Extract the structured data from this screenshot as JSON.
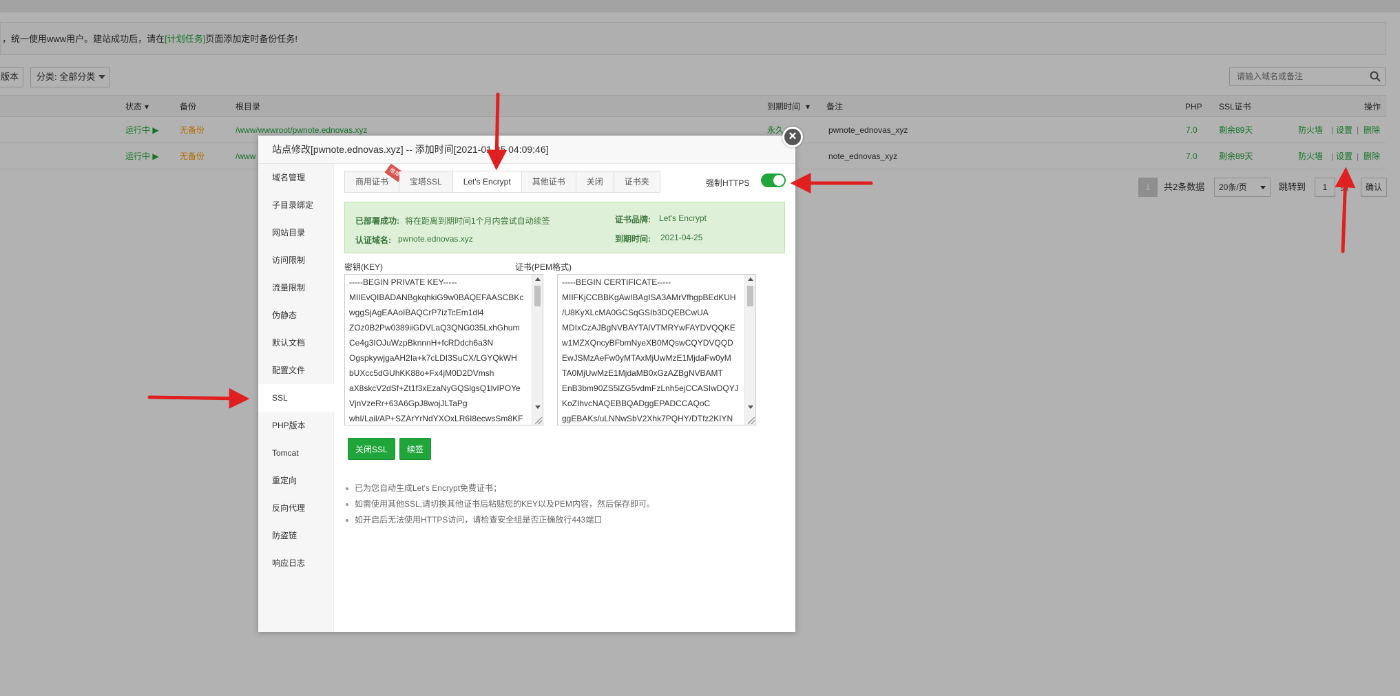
{
  "background": {
    "notice": {
      "text": "，统一使用www用户。建站成功后，请在",
      "link": "[计划任务]",
      "text_after": "页面添加定时备份任务!"
    },
    "toolbar": {
      "version_button": "版本",
      "category_select": "分类: 全部分类"
    },
    "search_placeholder": "请输入域名或备注",
    "table": {
      "headers": {
        "status": "状态",
        "backup": "备份",
        "root": "根目录",
        "expire": "到期时间",
        "remark": "备注",
        "php": "PHP",
        "ssl": "SSL证书",
        "ops": "操作"
      },
      "rows": [
        {
          "status": "运行中",
          "backup": "无备份",
          "root": "/www/wwwroot/pwnote.ednovas.xyz",
          "expire": "永久",
          "remark": "pwnote_ednovas_xyz",
          "php": "7.0",
          "ssl": "剩余89天",
          "firewall": "防火墙",
          "settings": "设置",
          "delete": "删除"
        },
        {
          "status": "运行中",
          "backup": "无备份",
          "root": "/www",
          "expire": "",
          "remark": "note_ednovas_xyz",
          "php": "7.0",
          "ssl": "剩余89天",
          "firewall": "防火墙",
          "settings": "设置",
          "delete": "删除"
        }
      ]
    },
    "pager": {
      "current": "1",
      "total": "共2条数据",
      "per_page": "20条/页",
      "jump_label": "跳转到",
      "jump_value": "1",
      "page_suffix": "页",
      "confirm": "确认"
    }
  },
  "dialog": {
    "title": "站点修改[pwnote.ednovas.xyz] -- 添加时间[2021-01-25 04:09:46]",
    "sidebar": [
      {
        "label": "域名管理"
      },
      {
        "label": "子目录绑定"
      },
      {
        "label": "网站目录"
      },
      {
        "label": "访问限制"
      },
      {
        "label": "流量限制"
      },
      {
        "label": "伪静态"
      },
      {
        "label": "默认文档"
      },
      {
        "label": "配置文件"
      },
      {
        "label": "SSL",
        "active": true
      },
      {
        "label": "PHP版本"
      },
      {
        "label": "Tomcat"
      },
      {
        "label": "重定向"
      },
      {
        "label": "反向代理"
      },
      {
        "label": "防盗链"
      },
      {
        "label": "响应日志"
      }
    ],
    "tabs": [
      {
        "label": "商用证书",
        "ribbon": "推荐"
      },
      {
        "label": "宝塔SSL"
      },
      {
        "label": "Let's Encrypt",
        "active": true
      },
      {
        "label": "其他证书"
      },
      {
        "label": "关闭"
      },
      {
        "label": "证书夹"
      }
    ],
    "force_https": {
      "label": "强制HTTPS",
      "enabled": true
    },
    "status": {
      "deployed_key": "已部署成功:",
      "deployed_val": "将在距离到期时间1个月内尝试自动续签",
      "domain_key": "认证域名:",
      "domain_val": "pwnote.ednovas.xyz",
      "brand_key": "证书品牌:",
      "brand_val": "Let's Encrypt",
      "expire_key": "到期时间:",
      "expire_val": "2021-04-25"
    },
    "key_label": "密钥(KEY)",
    "cert_label": "证书(PEM格式)",
    "key_lines": [
      "-----BEGIN PRIVATE KEY-----",
      "MIIEvQIBADANBgkqhkiG9w0BAQEFAASCBKc",
      "wggSjAgEAAoIBAQCrP7izTcEm1dl4",
      "ZOz0B2Pw0389iiGDVLaQ3QNG035LxhGhum",
      "Ce4g3IOJuWzpBknnnH+fcRDdch6a3N",
      "OgspkywjgaAH2Ia+k7cLDI3SuCX/LGYQkWH",
      "bUXcc5dGUhKK88o+Fx4jM0D2DVmsh",
      "aX8skcV2dSf+Zt1f3xEzaNyGQSlgsQ1lvIPOYe",
      "VjnVzeRr+63A6GpJ8wojJLTaPg",
      "whI/Lail/AP+SZArYrNdYXOxLR6I8ecwsSm8KF"
    ],
    "cert_lines": [
      "-----BEGIN CERTIFICATE-----",
      "MIIFKjCCBBKgAwIBAgISA3AMrVfhgpBEdKUH",
      "/U8KyXLcMA0GCSqGSIb3DQEBCwUA",
      "MDIxCzAJBgNVBAYTAlVTMRYwFAYDVQQKE",
      "w1MZXQncyBFbmNyeXB0MQswCQYDVQQD",
      "EwJSMzAeFw0yMTAxMjUwMzE1MjdaFw0yM",
      "TA0MjUwMzE1MjdaMB0xGzAZBgNVBAMT",
      "EnB3bm90ZS5lZG5vdmFzLnh5ejCCASIwDQYJ",
      "KoZIhvcNAQEBBQADggEPADCCAQoC",
      "ggEBAKs/uLNNwSbV2Xhk7PQHY/DTfz2KIYN"
    ],
    "buttons": {
      "close_ssl": "关闭SSL",
      "renew": "续签"
    },
    "notes": [
      "已为您自动生成Let's Encrypt免费证书；",
      "如需使用其他SSL,请切换其他证书后粘贴您的KEY以及PEM内容，然后保存即可。",
      "如开启后无法使用HTTPS访问，请检查安全组是否正确放行443端口"
    ]
  },
  "colors": {
    "accent": "#20a53a",
    "annotation": "#e02020",
    "orange": "#ff9900"
  }
}
